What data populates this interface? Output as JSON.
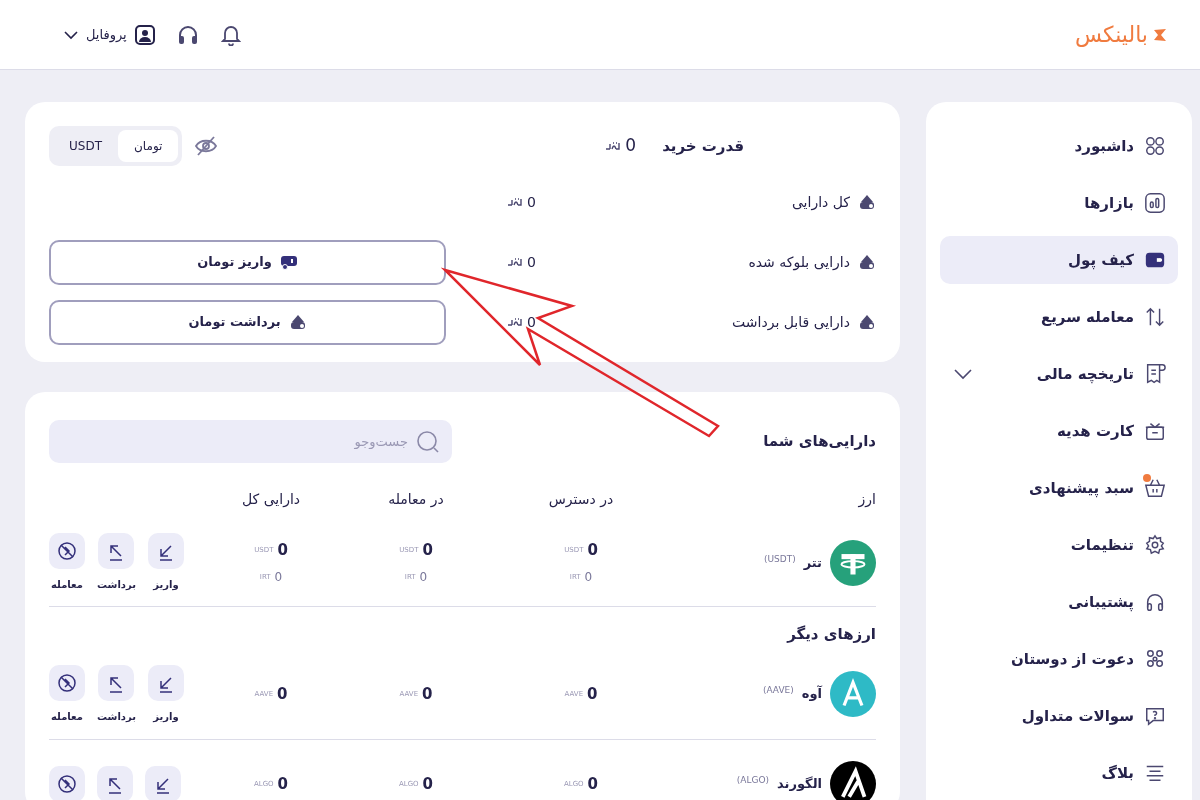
{
  "header": {
    "logo": "بالینکس",
    "profile": "پروفایل"
  },
  "sidebar": {
    "items": [
      {
        "label": "داشبورد",
        "kind": "link",
        "selected": false,
        "notification": false
      },
      {
        "label": "بازارها",
        "kind": "link",
        "selected": false,
        "notification": false
      },
      {
        "label": "کیف پول",
        "kind": "link",
        "selected": true,
        "notification": false
      },
      {
        "label": "معامله سریع",
        "kind": "link",
        "selected": false,
        "notification": false
      },
      {
        "label": "تاریخچه مالی",
        "kind": "group",
        "expanded": false,
        "selected": false,
        "notification": false
      },
      {
        "label": "کارت هدیه",
        "kind": "link",
        "selected": false,
        "notification": false
      },
      {
        "label": "سبد پیشنهادی",
        "kind": "link",
        "selected": false,
        "notification": true
      },
      {
        "label": "تنظیمات",
        "kind": "link",
        "selected": false,
        "notification": false
      },
      {
        "label": "پشتیبانی",
        "kind": "link",
        "selected": false,
        "notification": false
      },
      {
        "label": "دعوت از دوستان",
        "kind": "link",
        "selected": false,
        "notification": false
      },
      {
        "label": "سوالات متداول",
        "kind": "link",
        "selected": false,
        "notification": false
      },
      {
        "label": "بلاگ",
        "kind": "link",
        "selected": false,
        "notification": false
      }
    ]
  },
  "balance": {
    "title": "قدرت خرید",
    "amount": "0",
    "currency_toggle": [
      {
        "label": "تومان",
        "selected": true
      },
      {
        "label": "USDT",
        "selected": false
      }
    ],
    "rows": [
      {
        "label": "کل دارایی",
        "value": "0"
      },
      {
        "label": "دارایی بلوکه شده",
        "value": "0"
      },
      {
        "label": "دارایی قابل برداشت",
        "value": "0"
      }
    ],
    "buttons": [
      {
        "label": "واریز تومان",
        "kind": "deposit"
      },
      {
        "label": "برداشت تومان",
        "kind": "withdraw"
      }
    ]
  },
  "assets": {
    "title": "دارایی‌های شما",
    "search": {
      "placeholder": "جست‌وجو"
    },
    "columns": [
      "ارز",
      "در دسترس",
      "در معامله",
      "دارایی کل"
    ],
    "groups": [
      {
        "rows": [
          {
            "name": "تتر",
            "symbol": "(USDT)",
            "kind": "usdt",
            "cells": [
              {
                "amount": "0",
                "unit": "USDT",
                "sub_amount": "0",
                "sub_unit": "IRT"
              },
              {
                "amount": "0",
                "unit": "USDT",
                "sub_amount": "0",
                "sub_unit": "IRT"
              },
              {
                "amount": "0",
                "unit": "USDT",
                "sub_amount": "0",
                "sub_unit": "IRT"
              }
            ],
            "actions": [
              {
                "kind": "deposit",
                "label": "واریز"
              },
              {
                "kind": "withdraw",
                "label": "برداشت"
              },
              {
                "kind": "trade",
                "label": "معامله"
              }
            ]
          }
        ]
      },
      {
        "title": "ارزهای دیگر",
        "rows": [
          {
            "name": "آوه",
            "symbol": "(AAVE)",
            "kind": "aave",
            "cells": [
              {
                "amount": "0",
                "unit": "AAVE"
              },
              {
                "amount": "0",
                "unit": "AAVE"
              },
              {
                "amount": "0",
                "unit": "AAVE"
              }
            ],
            "actions": [
              {
                "kind": "deposit",
                "label": "واریز"
              },
              {
                "kind": "withdraw",
                "label": "برداشت"
              },
              {
                "kind": "trade",
                "label": "معامله"
              }
            ]
          },
          {
            "name": "الگورند",
            "symbol": "(ALGO)",
            "kind": "algo",
            "cells": [
              {
                "amount": "0",
                "unit": "ALGO"
              },
              {
                "amount": "0",
                "unit": "ALGO"
              },
              {
                "amount": "0",
                "unit": "ALGO"
              }
            ],
            "actions": [
              {
                "kind": "deposit"
              },
              {
                "kind": "withdraw"
              },
              {
                "kind": "trade"
              }
            ]
          }
        ]
      }
    ]
  }
}
